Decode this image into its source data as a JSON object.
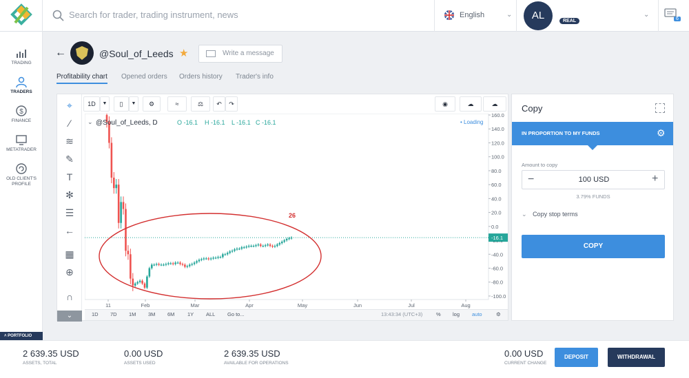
{
  "header": {
    "search_placeholder": "Search for trader, trading instrument, news",
    "language": "English",
    "avatar_initials": "AL",
    "account_badge": "REAL",
    "messages_count": "6"
  },
  "sidebar": {
    "items": [
      {
        "label": "TRADING",
        "icon": "trading-chart-icon"
      },
      {
        "label": "TRADERS",
        "icon": "traders-icon"
      },
      {
        "label": "FINANCE",
        "icon": "finance-dollar-icon"
      },
      {
        "label": "METATRADER",
        "icon": "metatrader-monitor-icon"
      },
      {
        "label": "OLD CLIENT'S PROFILE",
        "icon": "old-profile-icon"
      }
    ],
    "portfolio_label": "PORTFOLIO"
  },
  "trader": {
    "name": "@Soul_of_Leeds",
    "write_message": "Write a message",
    "tabs": [
      "Profitability chart",
      "Opened orders",
      "Orders history",
      "Trader's info"
    ]
  },
  "chart": {
    "interval": "1D",
    "legend_symbol": "@Soul_of_Leeds, D",
    "legend_o": "O -16.1",
    "legend_h": "H -16.1",
    "legend_l": "L -16.1",
    "legend_c": "C -16.1",
    "loading": "Loading",
    "annotation": "26",
    "price_tag": "-16.1",
    "time": "13:43:34 (UTC+3)",
    "ranges": [
      "1D",
      "7D",
      "1M",
      "3M",
      "6M",
      "1Y",
      "ALL",
      "Go to..."
    ],
    "scale_opts": [
      "%",
      "log",
      "auto"
    ]
  },
  "chart_data": {
    "type": "candlestick",
    "title": "",
    "x_ticks": [
      "11",
      "Feb",
      "Mar",
      "Apr",
      "May",
      "Jun",
      "Jul",
      "Aug"
    ],
    "y_ticks": [
      "160.0",
      "140.0",
      "120.0",
      "100.0",
      "80.0",
      "60.0",
      "40.0",
      "20.0",
      "0.0",
      "-20.0",
      "-40.0",
      "-60.0",
      "-80.0",
      "-100.0"
    ],
    "ylim": [
      -105,
      162
    ],
    "last_value": -16.1,
    "closes": [
      150,
      120,
      70,
      55,
      60,
      5,
      35,
      25,
      -35,
      -40,
      -75,
      -85,
      -82,
      -80,
      -78,
      -82,
      -88,
      -72,
      -60,
      -55,
      -55,
      -54,
      -55,
      -55,
      -55,
      -54,
      -53,
      -53,
      -54,
      -52,
      -52,
      -54,
      -55,
      -58,
      -57,
      -55,
      -54,
      -52,
      -50,
      -48,
      -47,
      -46,
      -46,
      -47,
      -46,
      -45,
      -45,
      -44,
      -44,
      -40,
      -40,
      -38,
      -36,
      -35,
      -33,
      -32,
      -32,
      -30,
      -30,
      -29,
      -28,
      -28,
      -28,
      -27,
      -26,
      -28,
      -28,
      -27,
      -26,
      -28,
      -29,
      -28,
      -26,
      -24,
      -22,
      -20,
      -18,
      -17,
      -16.1
    ]
  },
  "copy": {
    "title": "Copy",
    "mode": "IN PROPORTION TO MY FUNDS",
    "amount_label": "Amount to copy",
    "amount_value": "100 USD",
    "funds_pct": "3.79% FUNDS",
    "stop_terms": "Copy stop terms",
    "button": "COPY"
  },
  "footer": {
    "assets_total": "2 639.35 USD",
    "assets_total_label": "ASSETS, TOTAL",
    "assets_used": "0.00 USD",
    "assets_used_label": "ASSETS USED",
    "available": "2 639.35 USD",
    "available_label": "AVAILABLE FOR OPERATIONS",
    "current_change": "0.00 USD",
    "current_change_label": "CURRENT CHANGE",
    "deposit": "DEPOSIT",
    "withdrawal": "WITHDRAWAL"
  },
  "colors": {
    "accent": "#3d8ede",
    "navy": "#263a5c",
    "up": "#26a69a",
    "down": "#ef5350",
    "annotation": "#d32f2f"
  }
}
